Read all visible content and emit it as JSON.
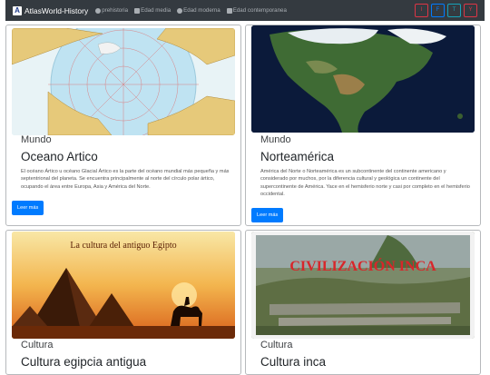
{
  "navbar": {
    "brand": "AtlasWorld-History",
    "brand_logo_letter": "A",
    "links": [
      {
        "label": "prehistoria",
        "icon": "person-icon"
      },
      {
        "label": "Edad media",
        "icon": "castle-icon"
      },
      {
        "label": "Edad moderna",
        "icon": "globe-icon"
      },
      {
        "label": "Edad contemporanea",
        "icon": "building-icon"
      }
    ],
    "social": [
      "I",
      "F",
      "T",
      "Y"
    ]
  },
  "cards": [
    {
      "category": "Mundo",
      "title": "Oceano Artico",
      "description": "El océano Ártico u océano Glacial Ártico es la parte del océano mundial más pequeña y más septentrional del planeta. Se encuentra principalmente al norte del círculo polar ártico, ocupando el área entre Europa, Asia y América del Norte.",
      "button": "Leer más",
      "image": "arctic-map"
    },
    {
      "category": "Mundo",
      "title": "Norteamérica",
      "description": "América del Norte o Norteamérica es un subcontinente del continente americano y considerado por muchos, por la diferencia cultural y geológica un continente del supercontinente de América. Yace en el hemisferio norte y casi por completo en el hemisferio occidental.",
      "button": "Leer más",
      "image": "north-america-satellite"
    },
    {
      "category": "Cultura",
      "title": "Cultura egipcia antigua",
      "image_caption": "La cultura del antiguo Egipto",
      "image": "egypt-pyramids"
    },
    {
      "category": "Cultura",
      "title": "Cultura inca",
      "image_caption": "CIVILIZACIÓN INCA",
      "image": "machu-picchu"
    }
  ],
  "colors": {
    "navbar": "#343a40",
    "primary": "#007bff",
    "danger": "#dc3545",
    "info": "#17a2b8"
  }
}
